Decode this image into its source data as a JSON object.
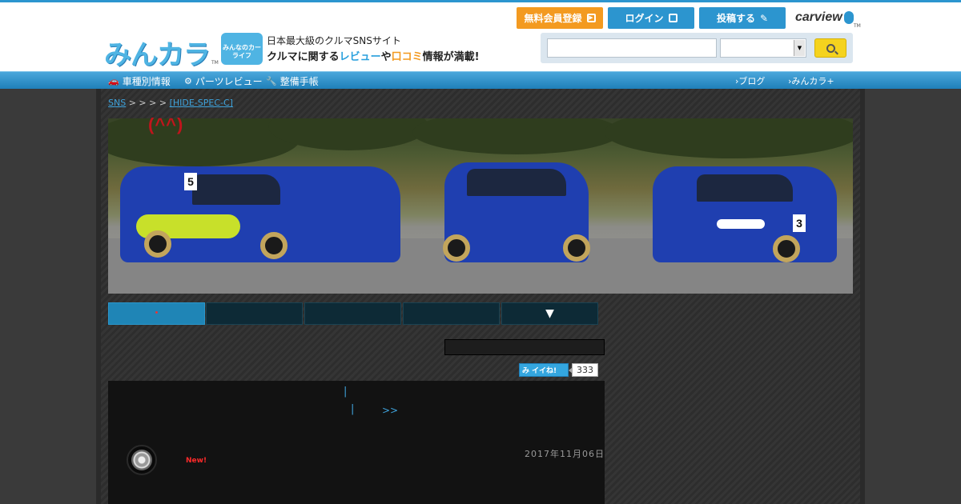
{
  "header": {
    "logo_text": "みんカラ",
    "logo_tm": "TM",
    "sub_logo": "みんなのカーライフ",
    "tagline1": "日本最大級のクルマSNSサイト",
    "tagline2_a": "クルマに関する",
    "tagline2_review": "レビュー",
    "tagline2_ya": "や",
    "tagline2_kuchikomi": "口コミ",
    "tagline2_b": "情報が満載!",
    "buttons": {
      "register": "無料会員登録",
      "login": "ログイン",
      "post": "投稿する"
    },
    "partner": "carview",
    "partner_tm": "TM",
    "search": {
      "value": "",
      "select_value": ""
    }
  },
  "nav": {
    "items": [
      "車種別情報",
      "パーツレビュー",
      "整備手帳"
    ],
    "right": [
      "ブログ",
      "みんカラ+"
    ]
  },
  "breadcrumb": {
    "root": "SNS",
    "seps": "> > > >",
    "current": "[HIDE-SPEC-C]"
  },
  "banner": {
    "title": "(^^)",
    "car_numbers": [
      "5",
      "3"
    ]
  },
  "tabs": [
    {
      "label": "・"
    },
    {
      "label": ""
    },
    {
      "label": ""
    },
    {
      "label": ""
    },
    {
      "label": "▼"
    }
  ],
  "iine": {
    "label": "イイね!",
    "count": "333"
  },
  "post": {
    "sep1": "|",
    "sep2": "|",
    "more": ">>",
    "date": "2017年11月06日",
    "new_badge": "New!"
  },
  "colors": {
    "accent": "#2c95cf",
    "orange": "#f39a20",
    "new_red": "#ff2a2a"
  }
}
